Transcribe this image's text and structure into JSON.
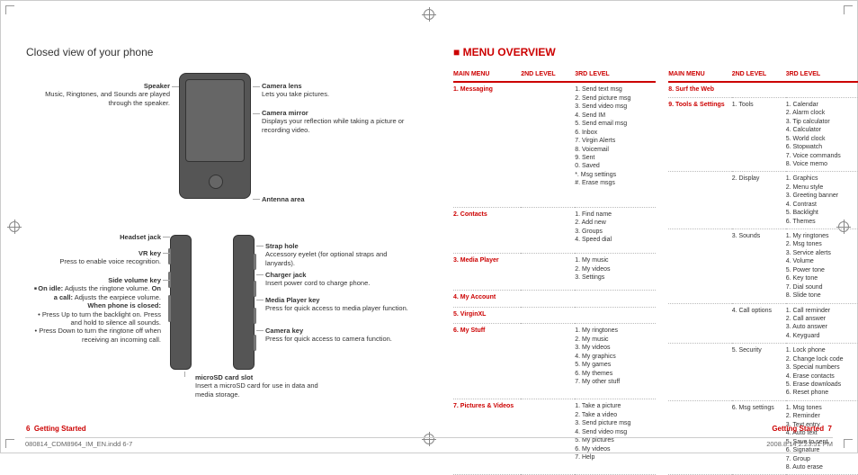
{
  "left": {
    "title": "Closed view of your phone",
    "callouts": {
      "speaker": {
        "label": "Speaker",
        "desc": "Music, Ringtones, and Sounds are played through the speaker."
      },
      "cameraLens": {
        "label": "Camera lens",
        "desc": "Lets you take pictures."
      },
      "cameraMirror": {
        "label": "Camera mirror",
        "desc": "Displays your reflection while taking a picture or recording video."
      },
      "antenna": {
        "label": "Antenna area",
        "desc": ""
      },
      "headset": {
        "label": "Headset jack",
        "desc": ""
      },
      "vr": {
        "label": "VR key",
        "desc": "Press to enable voice recognition."
      },
      "sideVol": {
        "label": "Side volume key",
        "desc": ""
      },
      "sideVol_on_idle_label": "On idle:",
      "sideVol_on_idle": "Adjusts the ringtone volume.",
      "sideVol_on_call_label": "On a call:",
      "sideVol_on_call": "Adjusts the earpiece volume.",
      "sideVol_closed_label": "When phone is closed:",
      "sideVol_up": "Press Up to turn the backlight on. Press and hold to silence all sounds.",
      "sideVol_down": "Press Down to turn the ringtone off when receiving an incoming call.",
      "strap": {
        "label": "Strap hole",
        "desc": "Accessory eyelet (for optional straps and lanyards)."
      },
      "charger": {
        "label": "Charger jack",
        "desc": "Insert power cord to charge phone."
      },
      "media": {
        "label": "Media Player key",
        "desc": "Press for quick access to media player function."
      },
      "camKey": {
        "label": "Camera key",
        "desc": "Press for quick access to camera function."
      },
      "microsd": {
        "label": "microSD card slot",
        "desc": "Insert a microSD card for use in data and media storage."
      }
    },
    "footer": {
      "page": "6",
      "section": "Getting Started"
    }
  },
  "right": {
    "title": "MENU OVERVIEW",
    "headers": {
      "c1": "MAIN MENU",
      "c2": "2ND LEVEL",
      "c3": "3RD LEVEL"
    },
    "tableA": [
      {
        "main": "1. Messaging",
        "c2": [],
        "c3": [
          "1. Send text msg",
          "2. Send picture msg",
          "3. Send video msg",
          "4. Send IM",
          "5. Send email msg",
          "6. Inbox",
          "7. Virgin Alerts",
          "8. Voicemail",
          "9. Sent",
          "0. Saved",
          "*. Msg settings",
          "#. Erase msgs"
        ]
      },
      {
        "main": "2. Contacts",
        "c2": [],
        "c3": [
          "1. Find name",
          "2. Add new",
          "3. Groups",
          "4. Speed dial"
        ]
      },
      {
        "main": "3. Media Player",
        "c2": [],
        "c3": [
          "1. My music",
          "2. My videos",
          "3. Settings"
        ]
      },
      {
        "main": "4. My Account",
        "c2": [],
        "c3": []
      },
      {
        "main": "5. VirginXL",
        "c2": [],
        "c3": []
      },
      {
        "main": "6. My Stuff",
        "c2": [],
        "c3": [
          "1. My ringtones",
          "2. My music",
          "3. My videos",
          "4. My graphics",
          "5. My games",
          "6. My themes",
          "7. My other stuff"
        ]
      },
      {
        "main": "7. Pictures & Videos",
        "c2": [],
        "c3": [
          "1. Take a picture",
          "2. Take a video",
          "3. Send picture msg",
          "4. Send video msg",
          "5. My pictures",
          "6. My videos",
          "7. Help"
        ]
      }
    ],
    "tableB": [
      {
        "main": "8. Surf the Web",
        "c2": [],
        "c3": []
      },
      {
        "main": "9. Tools & Settings",
        "c2fill": "1. Tools",
        "c3": [
          "1. Calendar",
          "2. Alarm clock",
          "3. Tip calculator",
          "4. Calculator",
          "5. World clock",
          "6. Stopwatch",
          "7. Voice commands",
          "8. Voice memo"
        ]
      },
      {
        "main": "",
        "c2fill": "2. Display",
        "c3": [
          "1. Graphics",
          "2. Menu style",
          "3. Greeting banner",
          "4. Contrast",
          "5. Backlight",
          "6. Themes"
        ]
      },
      {
        "main": "",
        "c2fill": "3. Sounds",
        "c3": [
          "1. My ringtones",
          "2. Msg tones",
          "3. Service alerts",
          "4. Volume",
          "5. Power tone",
          "6. Key tone",
          "7. Dial sound",
          "8. Slide tone"
        ]
      },
      {
        "main": "",
        "c2fill": "4. Call options",
        "c3": [
          "1. Call reminder",
          "2. Call answer",
          "3. Auto answer",
          "4. Keyguard"
        ]
      },
      {
        "main": "",
        "c2fill": "5. Security",
        "c3": [
          "1. Lock phone",
          "2. Change lock code",
          "3. Special numbers",
          "4. Erase contacts",
          "5. Erase downloads",
          "6. Reset phone"
        ]
      },
      {
        "main": "",
        "c2fill": "6. Msg settings",
        "c3": [
          "1. Msg tones",
          "2. Reminder",
          "3. Text entry",
          "4. Auto text",
          "5. Save to sent",
          "6. Signature",
          "7. Group",
          "8. Auto erase"
        ]
      }
    ],
    "footer": {
      "page": "7",
      "section": "Getting Started"
    }
  },
  "indd": {
    "file": "080814_CDM8964_IM_EN.indd   6-7",
    "stamp": "2008.8.14   2:23:51 PM"
  }
}
